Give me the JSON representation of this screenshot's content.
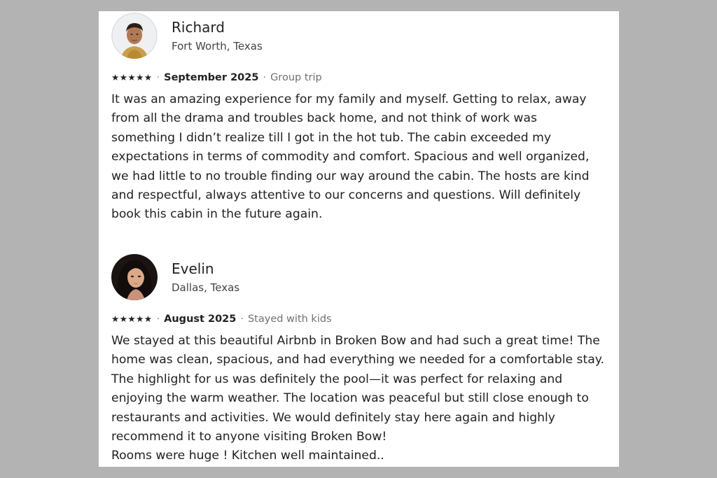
{
  "reviews": [
    {
      "name": "Richard",
      "location": "Fort Worth, Texas",
      "rating": 5,
      "stars": "★★★★★",
      "separator": "·",
      "date": "September 2025",
      "trip_type": "Group trip",
      "lines": [
        "It was an amazing experience for my family and myself. Getting to relax, away",
        "from all the drama and troubles back home,  and not think of work was",
        "something I didn’t realize till I got in the hot tub. The cabin exceeded my",
        "expectations in terms of commodity and comfort. Spacious and well organized,",
        "we had little to no trouble finding our way around the cabin. The hosts are kind",
        "and respectful, always attentive to our concerns and questions. Will definitely",
        "book this cabin in the future again."
      ]
    },
    {
      "name": "Evelin",
      "location": "Dallas, Texas",
      "rating": 5,
      "stars": "★★★★★",
      "separator": "·",
      "date": "August 2025",
      "trip_type": "Stayed with kids",
      "lines": [
        "We stayed at this beautiful Airbnb in Broken Bow and had such a great time! The",
        "home was clean, spacious, and had everything we needed for a comfortable stay.",
        "The highlight for us was definitely the pool—it was perfect for relaxing and",
        "enjoying the warm weather. The location was peaceful but still close enough to",
        "restaurants and activities. We would definitely stay here again and highly",
        "recommend it to anyone visiting Broken Bow!",
        "Rooms were huge ! Kitchen well maintained.."
      ]
    }
  ],
  "colors": {
    "page_background": "#b3b3b3",
    "card_background": "#ffffff",
    "text_primary": "#222222",
    "text_secondary": "#717171"
  }
}
